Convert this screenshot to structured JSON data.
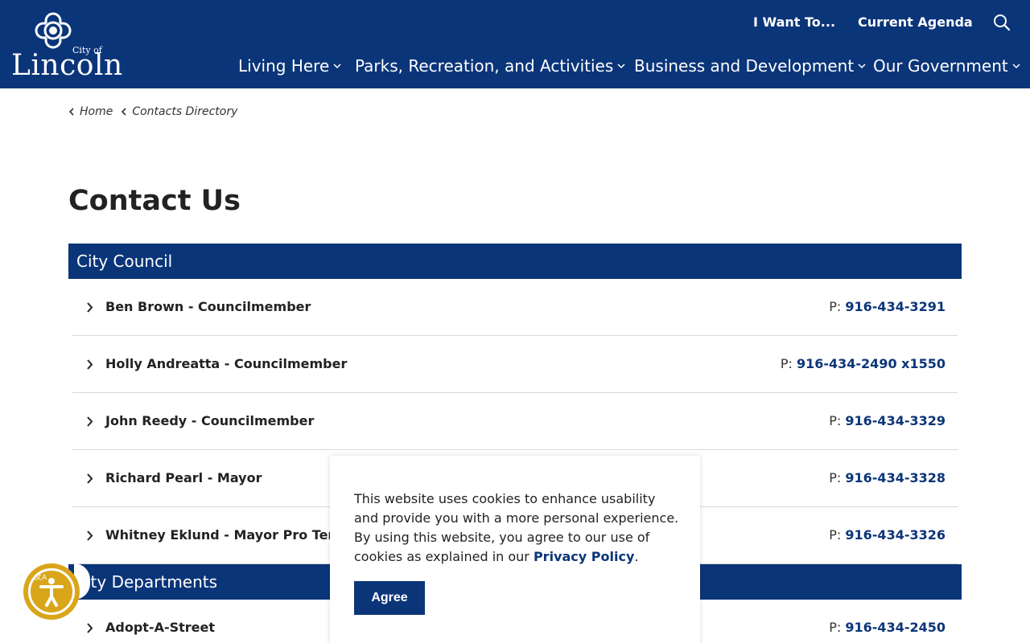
{
  "logo": {
    "city_of": "City of",
    "name": "Lincoln"
  },
  "utility_nav": {
    "want_to": "I Want To...",
    "agenda": "Current Agenda"
  },
  "main_nav": [
    {
      "label": "Living Here"
    },
    {
      "label": "Parks, Recreation, and Activities"
    },
    {
      "label": "Business and Development"
    },
    {
      "label": "Our Government"
    }
  ],
  "breadcrumb": {
    "home": "Home",
    "current": "Contacts Directory"
  },
  "page_title": "Contact Us",
  "sections": {
    "council": "City Council",
    "departments": "ity Departments"
  },
  "council_rows": [
    {
      "name": "Ben Brown - Councilmember",
      "phone_prefix": "P: ",
      "phone": "916-434-3291"
    },
    {
      "name": "Holly Andreatta - Councilmember",
      "phone_prefix": "P: ",
      "phone": "916-434-2490 x1550"
    },
    {
      "name": "John Reedy - Councilmember",
      "phone_prefix": "P: ",
      "phone": "916-434-3329"
    },
    {
      "name": "Richard Pearl - Mayor",
      "phone_prefix": "P: ",
      "phone": "916-434-3328"
    },
    {
      "name": "Whitney Eklund - Mayor Pro Tem",
      "phone_prefix": "P: ",
      "phone": "916-434-3326"
    }
  ],
  "department_rows": [
    {
      "name": "Adopt-A-Street",
      "phone_prefix": "P: ",
      "phone": "916-434-2450"
    }
  ],
  "cookie": {
    "text": "This website uses cookies to enhance usability and provide you with a more personal experience. By using this website, you agree to our use of cookies as explained in our ",
    "link": "Privacy Policy",
    "end": ".",
    "agree": "Agree"
  },
  "colors": {
    "brand": "#0b3579",
    "accessibility": "#d9a51a"
  },
  "icons": {
    "search": "search-icon",
    "accessibility": "accessibility-icon"
  }
}
